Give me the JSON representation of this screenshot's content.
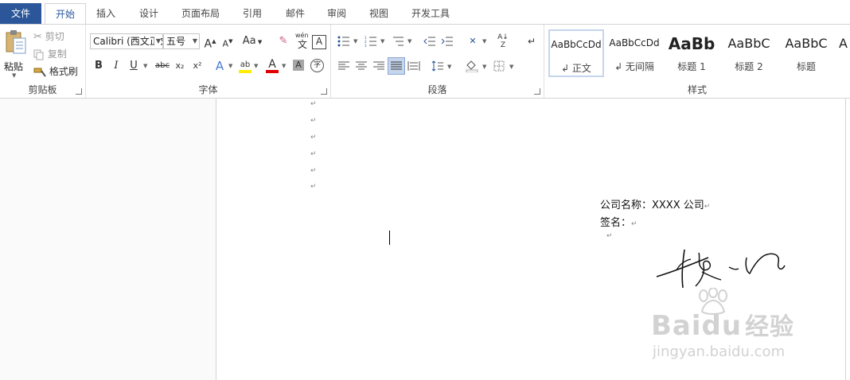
{
  "tabs": [
    {
      "label": "文件"
    },
    {
      "label": "开始"
    },
    {
      "label": "插入"
    },
    {
      "label": "设计"
    },
    {
      "label": "页面布局"
    },
    {
      "label": "引用"
    },
    {
      "label": "邮件"
    },
    {
      "label": "审阅"
    },
    {
      "label": "视图"
    },
    {
      "label": "开发工具"
    }
  ],
  "clipboard": {
    "group_label": "剪贴板",
    "paste": "粘贴",
    "cut": "剪切",
    "copy": "复制",
    "format_painter": "格式刷"
  },
  "font": {
    "group_label": "字体",
    "font_name": "Calibri (西文正文)",
    "font_size": "五号",
    "bold": "B",
    "italic": "I",
    "underline": "U",
    "strike": "abc",
    "subscript": "x₂",
    "superscript": "x²",
    "aa": "Aa",
    "grow": "A",
    "shrink": "A",
    "phonetic": "wén",
    "phonetic_char": "文",
    "border_char": "A",
    "font_color_char": "A",
    "shade_char": "A",
    "enclose_char": "字"
  },
  "paragraph": {
    "group_label": "段落"
  },
  "styles": {
    "group_label": "样式",
    "items": [
      {
        "sample": "AaBbCcDd",
        "name": "↲ 正文"
      },
      {
        "sample": "AaBbCcDd",
        "name": "↲ 无间隔"
      },
      {
        "sample": "AaBb",
        "name": "标题 1"
      },
      {
        "sample": "AaBbC",
        "name": "标题 2"
      },
      {
        "sample": "AaBbC",
        "name": "标题"
      },
      {
        "sample": "A",
        "name": ""
      }
    ]
  },
  "document": {
    "paragraph_mark": "↵",
    "company_line": "公司名称：XXXX 公司",
    "signature_line": "签名："
  },
  "watermark": {
    "brand": "Baidu",
    "brand_cn": "经验",
    "url": "jingyan.baidu.com"
  }
}
